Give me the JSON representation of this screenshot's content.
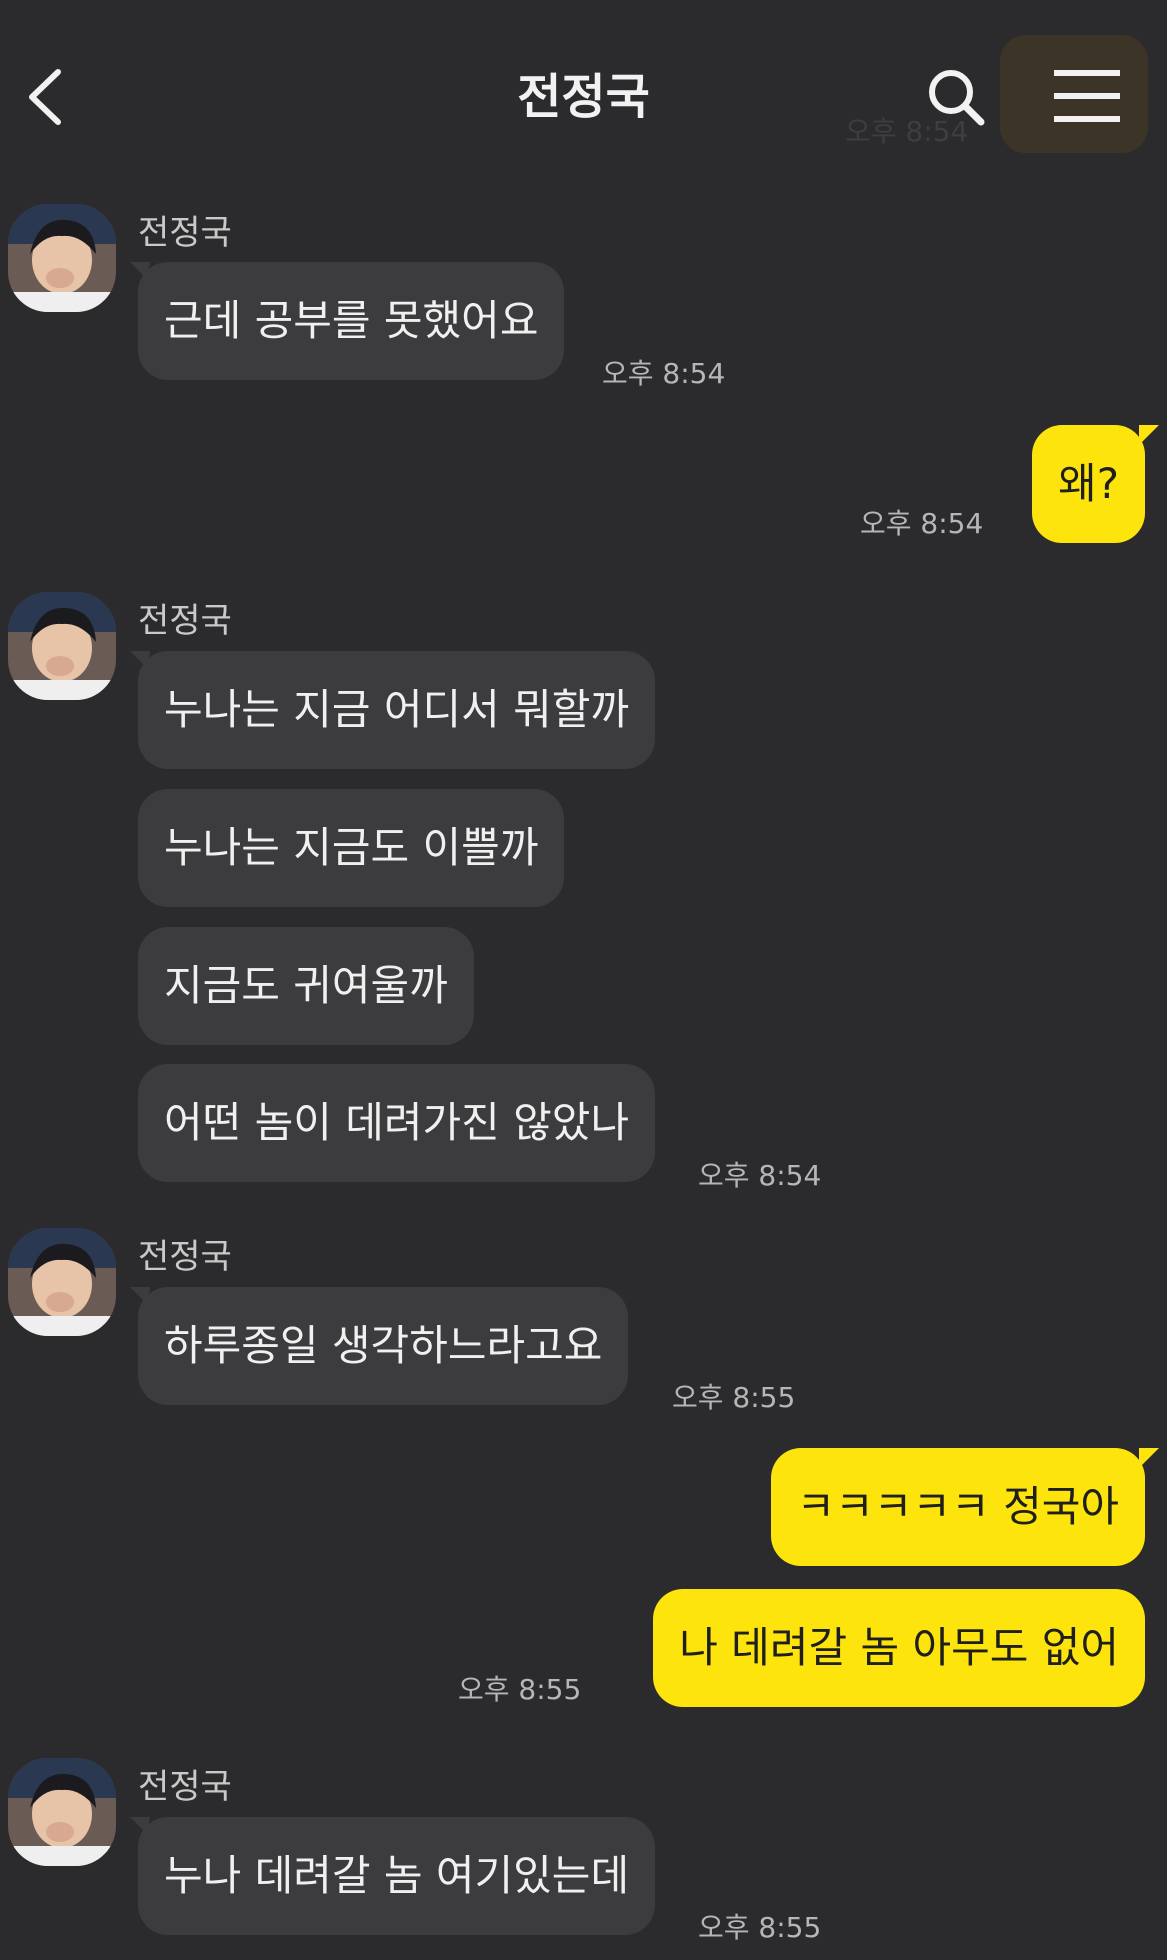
{
  "header": {
    "title": "전정국",
    "ghost_time": "오후 8:54"
  },
  "messages": [
    {
      "from": "friend",
      "sender": "전정국",
      "texts": [
        "근데 공부를 못했어요"
      ],
      "time": "오후 8:54"
    },
    {
      "from": "me",
      "texts": [
        "왜?"
      ],
      "time": "오후 8:54"
    },
    {
      "from": "friend",
      "sender": "전정국",
      "texts": [
        "누나는 지금 어디서 뭐할까",
        "누나는 지금도 이쁠까",
        "지금도 귀여울까",
        "어떤 놈이 데려가진 않았나"
      ],
      "time": "오후 8:54"
    },
    {
      "from": "friend",
      "sender": "전정국",
      "texts": [
        "하루종일 생각하느라고요"
      ],
      "time": "오후 8:55"
    },
    {
      "from": "me",
      "texts": [
        "ㅋㅋㅋㅋㅋ 정국아",
        "나 데려갈 놈 아무도 없어"
      ],
      "time": "오후 8:55"
    },
    {
      "from": "friend",
      "sender": "전정국",
      "texts": [
        "누나 데려갈 놈 여기있는데"
      ],
      "time": "오후 8:55"
    }
  ],
  "colors": {
    "background": "#2b2b2d",
    "friend_bubble": "#3c3c3f",
    "my_bubble": "#fde40c"
  }
}
